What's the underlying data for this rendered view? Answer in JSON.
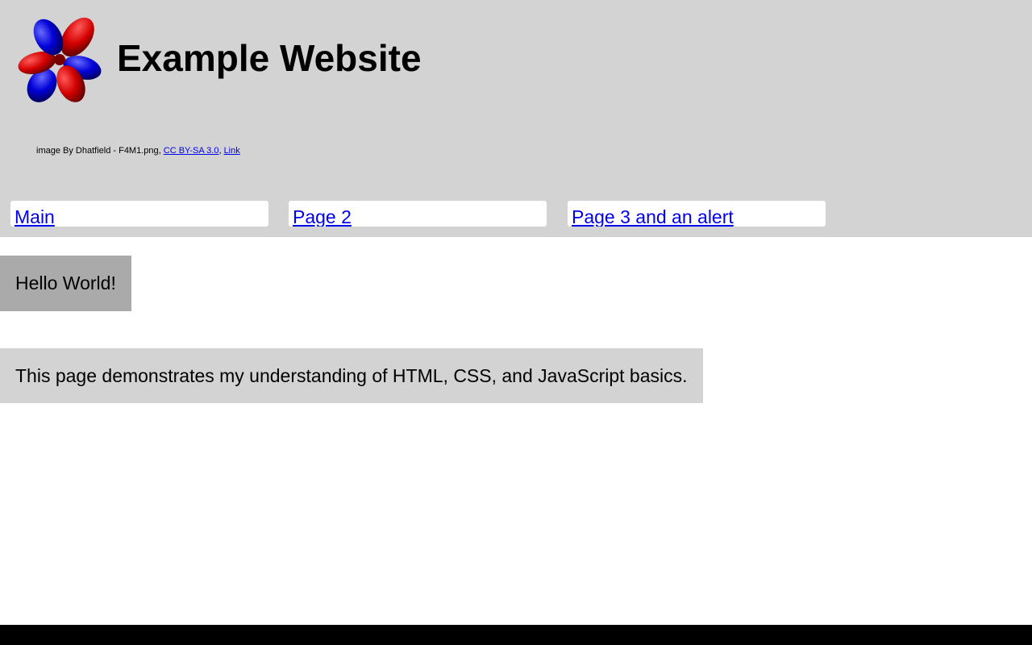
{
  "header": {
    "title": "Example Website",
    "logo_icon": "orbital-lobes-icon",
    "credit": {
      "prefix": "image By Dhatfield - F4M1.png, ",
      "license_link": "CC BY-SA 3.0",
      "separator": ", ",
      "source_link": "Link"
    }
  },
  "nav": {
    "items": [
      {
        "label": "Main"
      },
      {
        "label": "Page 2"
      },
      {
        "label": "Page 3 and an alert"
      }
    ]
  },
  "main": {
    "greeting": "Hello World!",
    "description": "This page demonstrates my understanding of HTML, CSS, and JavaScript basics."
  },
  "colors": {
    "header_bg": "#d3d3d3",
    "greeting_bg": "#aaaaaa",
    "description_bg": "#d3d3d3",
    "link": "#0000ee",
    "footer_bg": "#000000",
    "logo_red": "#d40000",
    "logo_blue": "#0000d8"
  }
}
